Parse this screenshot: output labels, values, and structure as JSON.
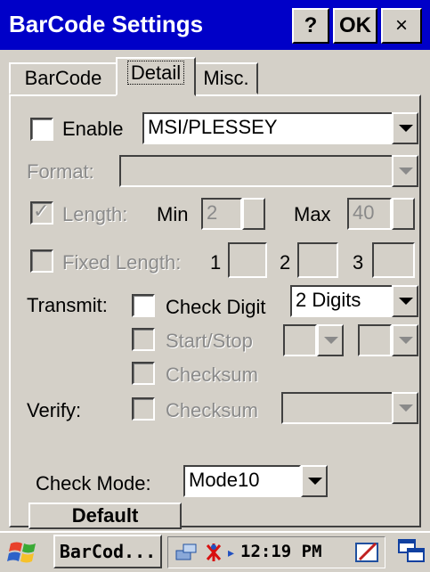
{
  "window": {
    "title": "BarCode Settings",
    "help_label": "?",
    "ok_label": "OK",
    "close_label": "×"
  },
  "tabs": [
    {
      "label": "BarCode"
    },
    {
      "label": "Detail",
      "active": true
    },
    {
      "label": "Misc."
    }
  ],
  "detail": {
    "enable_label": "Enable",
    "enable_checked": false,
    "symbology": "MSI/PLESSEY",
    "format_label": "Format:",
    "format_value": "",
    "length_label": "Length:",
    "length_checked": true,
    "min_label": "Min",
    "min_value": "2",
    "max_label": "Max",
    "max_value": "40",
    "fixed_length_label": "Fixed Length:",
    "fixed_length_checked": false,
    "fixed_1_label": "1",
    "fixed_2_label": "2",
    "fixed_3_label": "3",
    "transmit_label": "Transmit:",
    "check_digit_label": "Check Digit",
    "check_digit_checked": false,
    "check_digit_option": "2 Digits",
    "start_stop_label": "Start/Stop",
    "checksum_label": "Checksum",
    "verify_label": "Verify:",
    "verify_checksum_label": "Checksum",
    "check_mode_label": "Check Mode:",
    "check_mode_value": "Mode10",
    "default_label": "Default"
  },
  "taskbar": {
    "task_label": "BarCod...",
    "time": "12:19 PM"
  },
  "colors": {
    "titlebar": "#0000c8",
    "face": "#d4d0c8"
  }
}
